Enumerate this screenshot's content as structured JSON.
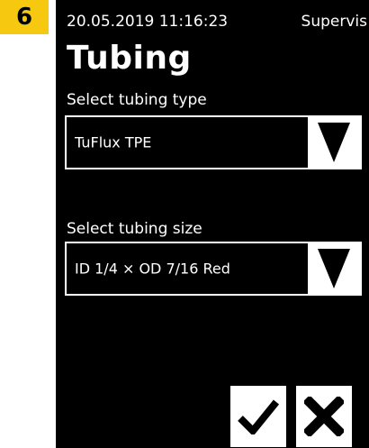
{
  "step_number": "6",
  "status": {
    "datetime": "20.05.2019  11:16:23",
    "user": "Supervis"
  },
  "page": {
    "title": "Tubing"
  },
  "tubing_type": {
    "label": "Select tubing type",
    "selected": "TuFlux TPE"
  },
  "tubing_size": {
    "label": "Select tubing size",
    "selected": "ID 1/4 × OD 7/16 Red"
  },
  "icons": {
    "dropdown": "triangle-down-icon",
    "confirm": "checkmark-icon",
    "cancel": "x-icon"
  },
  "colors": {
    "screen_background": "#000000",
    "screen_text": "#ffffff",
    "step_badge": "#f6c80f"
  }
}
